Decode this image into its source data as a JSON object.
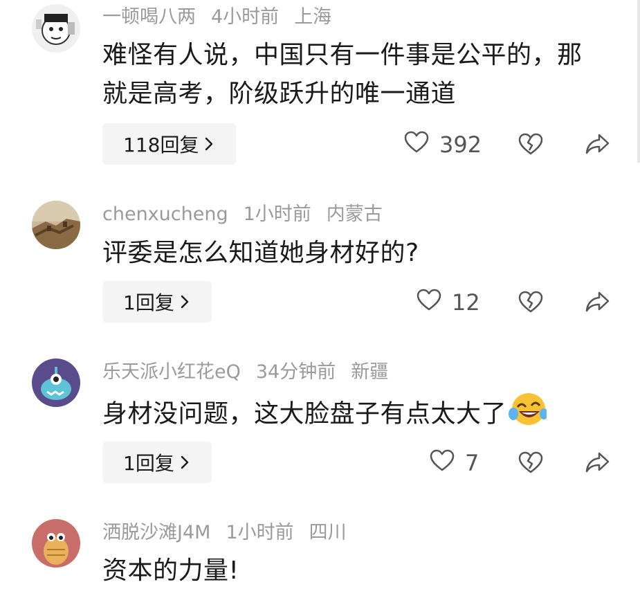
{
  "comments": [
    {
      "username": "一顿喝八两",
      "time": "4小时前",
      "location": "上海",
      "text": "难怪有人说，中国只有一件事是公平的，那就是高考，阶级跃升的唯一通道",
      "replies": "118回复",
      "likes": "392",
      "avatar_icon": "cartoon-face-avatar"
    },
    {
      "username": "chenxucheng",
      "time": "1小时前",
      "location": "内蒙古",
      "text": "评委是怎么知道她身材好的?",
      "replies": "1回复",
      "likes": "12",
      "avatar_icon": "great-wall-avatar"
    },
    {
      "username": "乐天派小红花eQ",
      "time": "34分钟前",
      "location": "新疆",
      "text": "身材没问题，这大脸盘子有点太大了",
      "replies": "1回复",
      "likes": "7",
      "avatar_icon": "blue-monster-avatar",
      "emoji": "laughing-crying-emoji"
    },
    {
      "username": "洒脱沙滩J4M",
      "time": "1小时前",
      "location": "四川",
      "text": "资本的力量!",
      "avatar_icon": "cartoon-creature-avatar"
    }
  ],
  "colors": {
    "meta": "#9a9a9a",
    "text": "#1a1a1a",
    "reply_bg": "#f4f4f4",
    "icon": "#555555"
  },
  "icons": {
    "like": "heart-outline-icon",
    "dislike": "broken-heart-icon",
    "share": "share-arrow-icon",
    "chevron": "chevron-right-icon"
  }
}
